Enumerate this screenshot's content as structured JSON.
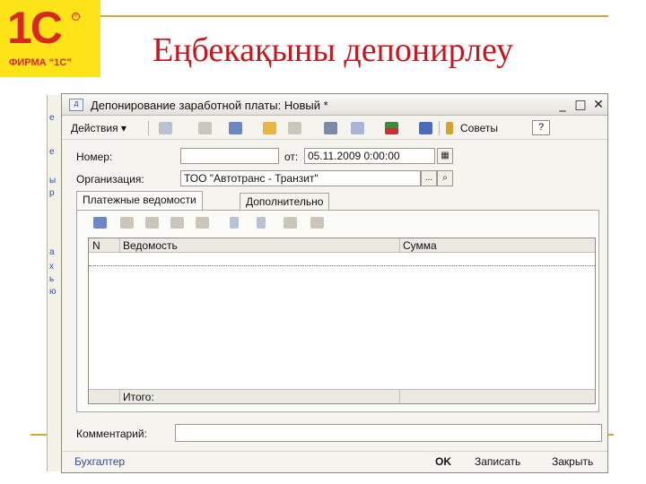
{
  "slide": {
    "logo_mark": "1С",
    "logo_text": "ФИРМА “1С”",
    "title": "Еңбекақыны депонирлеу",
    "accent_color": "#c8161e",
    "logo_bg": "#fde318"
  },
  "background_window": {
    "fragments": [
      "e",
      "e",
      "ы",
      "р",
      "а",
      "х",
      "ь",
      "ю"
    ]
  },
  "window": {
    "title": "Депонирование заработной платы: Новый *",
    "controls": {
      "minimize": "_",
      "maximize": "□",
      "close": "✕"
    }
  },
  "toolbar": {
    "actions_label": "Действия ▾",
    "advice_label": "Советы",
    "help_label": "?",
    "icons": [
      "add-row-icon",
      "copy-icon",
      "move-icon",
      "structure-icon",
      "edit-icon",
      "list-icon",
      "settings-list-icon",
      "dt-kt-icon",
      "report-icon",
      "advice-icon"
    ]
  },
  "form": {
    "number_label": "Номер:",
    "number_value": "",
    "date_label": "от:",
    "date_value": "05.11.2009  0:00:00",
    "org_label": "Организация:",
    "org_value": "ТОО \"Автотранс - Транзит\"",
    "org_dots": "...",
    "comment_label": "Комментарий:",
    "comment_value": ""
  },
  "tabs": [
    {
      "label": "Платежные ведомости",
      "active": true
    },
    {
      "label": "Дополнительно",
      "active": false
    }
  ],
  "table": {
    "columns": [
      "N",
      "Ведомость",
      "Сумма"
    ],
    "rows": [],
    "footer_label": "Итого:"
  },
  "status": {
    "user": "Бухгалтер",
    "ok_label": "OK",
    "save_label": "Записать",
    "close_label": "Закрыть"
  }
}
